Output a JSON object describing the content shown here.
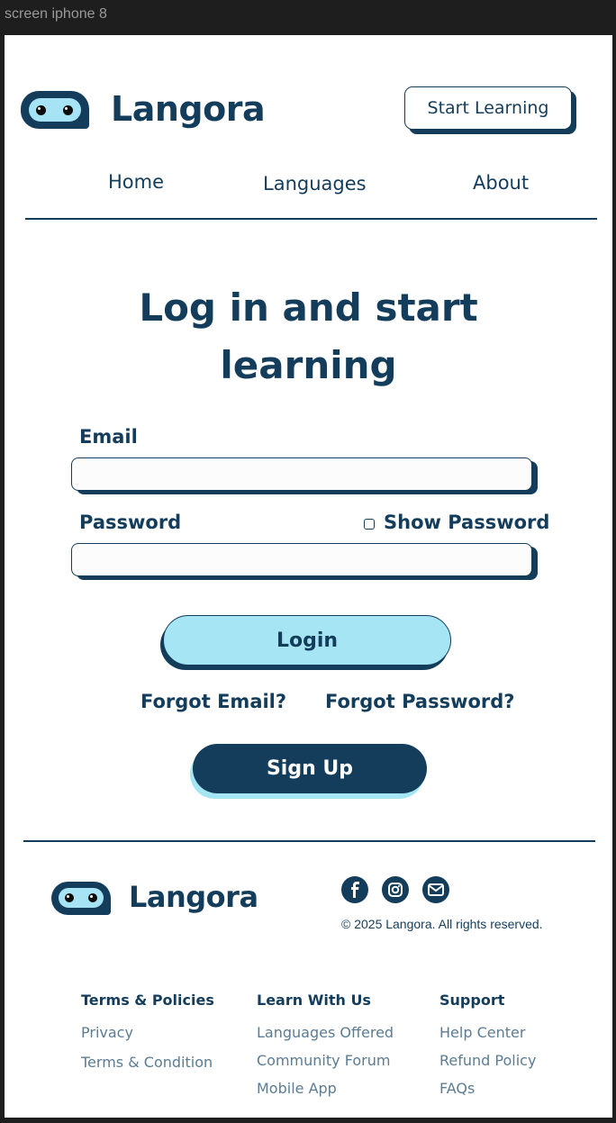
{
  "frame_label": "screen iphone 8",
  "header": {
    "brand": "Langora",
    "cta_label": "Start Learning"
  },
  "nav": [
    "Home",
    "Languages",
    "About"
  ],
  "login": {
    "title_line1": "Log in and start",
    "title_line2": "learning",
    "email_label": "Email",
    "email_value": "",
    "password_label": "Password",
    "password_value": "",
    "show_password_label": "Show Password",
    "show_password_checked": false,
    "login_label": "Login",
    "forgot_email": "Forgot Email?",
    "forgot_password": "Forgot Password?",
    "signup_label": "Sign Up"
  },
  "footer": {
    "brand": "Langora",
    "social": [
      "facebook-icon",
      "instagram-icon",
      "mail-icon"
    ],
    "copyright": "© 2025 Langora. All rights reserved.",
    "columns": [
      {
        "heading": "Terms & Policies",
        "items": [
          "Privacy",
          "Terms & Condition"
        ]
      },
      {
        "heading": "Learn With Us",
        "items": [
          "Languages Offered",
          "Community Forum",
          "Mobile App"
        ]
      },
      {
        "heading": "Support",
        "items": [
          "Help Center",
          "Refund Policy",
          "FAQs"
        ]
      }
    ]
  },
  "colors": {
    "navy": "#143d5c",
    "accent": "#a6e6f4"
  }
}
